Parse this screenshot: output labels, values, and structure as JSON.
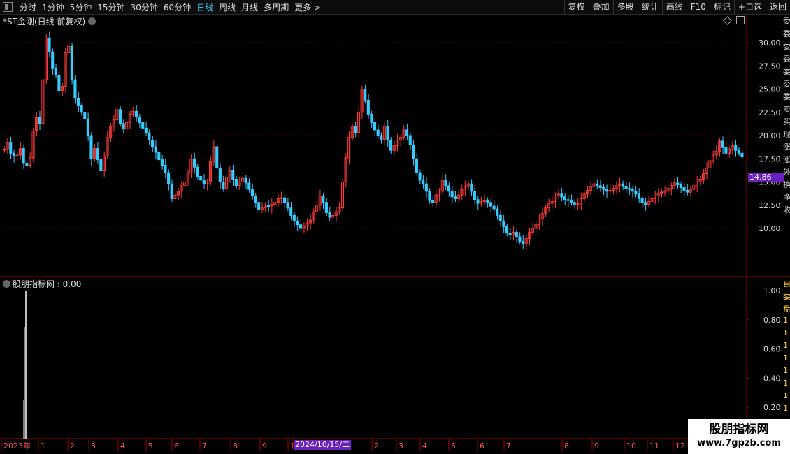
{
  "toolbar": {
    "timeframes": [
      "分时",
      "1分钟",
      "5分钟",
      "15分钟",
      "30分钟",
      "60分钟",
      "日线",
      "周线",
      "月线",
      "多周期",
      "更多 >"
    ],
    "active": "日线",
    "right_buttons": [
      "复权",
      "叠加",
      "多股",
      "统计",
      "画线",
      "F10",
      "标记",
      "+自选",
      "返回"
    ]
  },
  "chart": {
    "title": "*ST金刚(日线 前复权)",
    "price_axis": [
      "30.00",
      "27.50",
      "25.00",
      "22.50",
      "20.00",
      "17.50",
      "15.00",
      "12.50",
      "10.00"
    ],
    "current_price": "14.86",
    "colors": {
      "up": "#ff3b3b",
      "down": "#33ccff",
      "grid": "#5a0000",
      "axis": "#aa0000"
    }
  },
  "indicator": {
    "title": "股朋指标网 : 0.00",
    "axis": [
      "1.00",
      "0.80",
      "0.60",
      "0.40",
      "0.20"
    ]
  },
  "date_axis": {
    "labels": [
      "2023年",
      "1",
      "2",
      "3",
      "4",
      "5",
      "6",
      "7",
      "8",
      "9",
      "1",
      "1",
      "2",
      "3",
      "4",
      "5",
      "6",
      "7",
      "8",
      "9",
      "10",
      "11",
      "12"
    ],
    "highlight": "2024/10/15/二"
  },
  "right_strip": [
    "委",
    "委",
    "委",
    "委",
    "委",
    "委",
    "委",
    "卖",
    "买",
    "现",
    "涨",
    "涨",
    "外",
    "换",
    "净",
    "收"
  ],
  "right_strip_lower": [
    "自",
    "委",
    "盘",
    "1",
    "1",
    "1",
    "1",
    "1",
    "1",
    "1",
    "1"
  ],
  "brand": {
    "name": "股朋指标网",
    "url": "www.7gpzb.com"
  },
  "chart_data": {
    "type": "candlestick",
    "y_axis": [
      10.0,
      30.0
    ],
    "series": [
      {
        "values": [
          18.5,
          19.2,
          18.1,
          17.8,
          17.9,
          18.6,
          17.0,
          16.8,
          17.6,
          20.5,
          22.0,
          21.3,
          26.0,
          30.5,
          29.0,
          27.2,
          26.5,
          24.8,
          25.3,
          28.9,
          29.6,
          26.0,
          24.0,
          23.2,
          22.5,
          21.8,
          20.0,
          17.5,
          18.6,
          17.4,
          16.2,
          17.8,
          19.8,
          21.0,
          21.7,
          22.8,
          21.3,
          20.7,
          21.4,
          22.3,
          22.6,
          22.0,
          21.4,
          20.8,
          20.3,
          19.5,
          18.8,
          18.2,
          17.4,
          16.8,
          16.0,
          14.8,
          13.2,
          13.6,
          14.0,
          14.6,
          15.0,
          16.0,
          17.5,
          16.6,
          15.6,
          15.2,
          14.8,
          15.0,
          17.2,
          18.8,
          16.5,
          15.0,
          14.3,
          15.5,
          16.2,
          15.3,
          14.6,
          15.0,
          15.4,
          14.9,
          14.2,
          13.5,
          12.8,
          12.0,
          12.2,
          12.5,
          12.3,
          12.6,
          12.8,
          13.2,
          13.3,
          12.8,
          12.2,
          11.4,
          10.8,
          10.4,
          10.0,
          10.3,
          10.6,
          10.9,
          11.8,
          12.5,
          13.5,
          12.8,
          11.7,
          11.2,
          11.4,
          11.8,
          12.2,
          15.0,
          17.6,
          19.8,
          21.0,
          20.3,
          22.5,
          25.0,
          23.8,
          22.3,
          21.4,
          20.6,
          20.0,
          19.6,
          21.0,
          19.5,
          18.4,
          18.9,
          19.5,
          19.8,
          20.6,
          20.0,
          19.0,
          17.5,
          16.0,
          15.2,
          14.8,
          14.0,
          13.0,
          12.8,
          13.6,
          14.0,
          15.2,
          14.6,
          14.0,
          13.4,
          13.2,
          13.6,
          14.2,
          14.5,
          14.8,
          14.0,
          13.1,
          12.7,
          12.9,
          13.0,
          12.8,
          12.4,
          12.1,
          11.4,
          10.8,
          10.2,
          9.5,
          9.3,
          9.6,
          9.1,
          8.6,
          8.3,
          8.9,
          9.6,
          10.0,
          10.4,
          11.0,
          11.6,
          12.2,
          12.7,
          12.9,
          13.5,
          13.7,
          13.4,
          13.1,
          13.0,
          12.8,
          12.6,
          12.7,
          13.2,
          13.7,
          14.1,
          14.5,
          14.8,
          14.6,
          14.4,
          14.2,
          14.0,
          14.1,
          14.3,
          14.6,
          14.8,
          14.5,
          14.3,
          14.2,
          14.0,
          13.7,
          13.2,
          12.8,
          12.6,
          12.9,
          13.2,
          13.5,
          13.7,
          13.9,
          14.0,
          14.3,
          14.6,
          14.9,
          14.7,
          14.4,
          14.1,
          13.9,
          14.2,
          14.6,
          15.0,
          15.3,
          15.9,
          16.5,
          17.3,
          17.9,
          18.3,
          19.4,
          18.7,
          18.1,
          18.5,
          18.9,
          18.4,
          18.1,
          17.7
        ]
      }
    ]
  }
}
